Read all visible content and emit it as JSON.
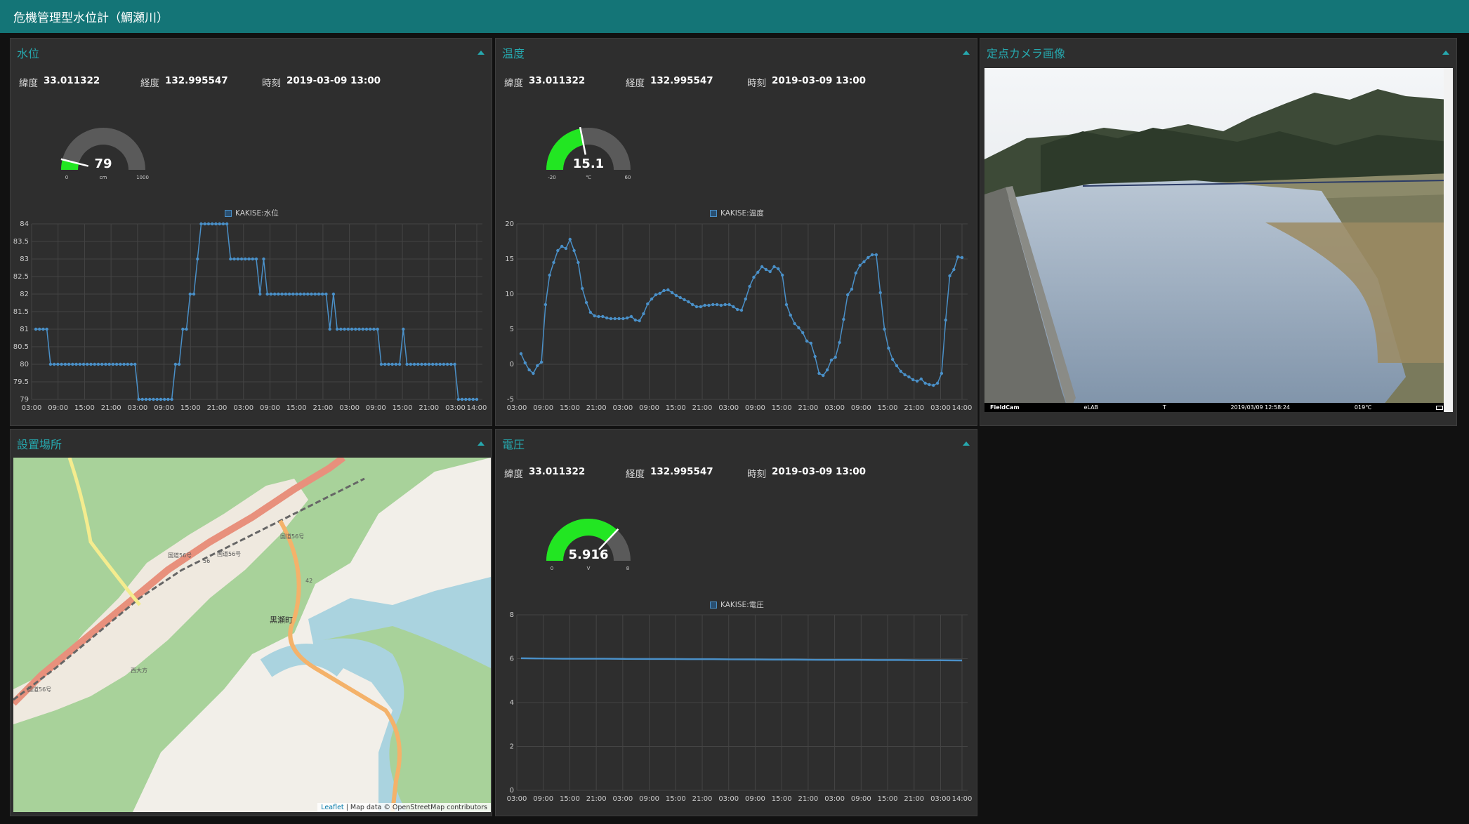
{
  "app": {
    "title": "危機管理型水位計（鯛瀬川）"
  },
  "colors": {
    "accent": "#26a8ae",
    "topbar": "#147577",
    "panel": "#2e2e2e",
    "gauge_fill": "#22e622",
    "gauge_track": "#5a5a5a",
    "line": "#4a90c8"
  },
  "location": {
    "lat_label": "緯度",
    "lat": "33.011322",
    "lon_label": "経度",
    "lon": "132.995547",
    "time_label": "時刻",
    "time": "2019-03-09 13:00"
  },
  "x_ticks": [
    "03:00",
    "09:00",
    "15:00",
    "21:00",
    "03:00",
    "09:00",
    "15:00",
    "21:00",
    "03:00",
    "09:00",
    "15:00",
    "21:00",
    "03:00",
    "09:00",
    "15:00",
    "21:00",
    "03:00",
    "14:00"
  ],
  "panels": {
    "water": {
      "title": "水位",
      "gauge": {
        "value": 79,
        "min": 0,
        "max": 1000,
        "unit": "cm",
        "value_text": "79",
        "min_text": "0",
        "max_text": "1000"
      },
      "legend": "KAKISE:水位",
      "y_ticks": [
        "84",
        "83.5",
        "83",
        "82.5",
        "82",
        "81.5",
        "81",
        "80.5",
        "80",
        "79.5",
        "79"
      ]
    },
    "temp": {
      "title": "温度",
      "gauge": {
        "value": 15.1,
        "min": -20,
        "max": 60,
        "unit": "℃",
        "value_text": "15.1",
        "min_text": "-20",
        "max_text": "60"
      },
      "legend": "KAKISE:温度",
      "y_ticks": [
        "20",
        "15",
        "10",
        "5",
        "0",
        "-5"
      ]
    },
    "camera": {
      "title": "定点カメラ画像",
      "strip": {
        "brand": "FieldCam",
        "lab": "eLAB",
        "mode": "T",
        "datetime": "2019/03/09 12:58:24",
        "temp": "019℃"
      }
    },
    "map": {
      "title": "設置場所",
      "place_main": "黒瀬町",
      "place_sub": "西大方",
      "roads": [
        "国道56号",
        "国道56号",
        "国道56号",
        "国道56号"
      ],
      "route_no": "42",
      "route_no2": "56",
      "attribution_link": "Leaflet",
      "attribution_text": "| Map data © OpenStreetMap contributors"
    },
    "voltage": {
      "title": "電圧",
      "gauge": {
        "value": 5.916,
        "min": 0,
        "max": 8,
        "unit": "V",
        "value_text": "5.916",
        "min_text": "0",
        "max_text": "8"
      },
      "legend": "KAKISE:電圧",
      "y_ticks": [
        "8",
        "6",
        "4",
        "2",
        "0"
      ]
    }
  },
  "chart_data": [
    {
      "type": "line",
      "series": [
        {
          "name": "KAKISE:水位",
          "values": [
            81,
            81,
            81,
            81,
            80,
            80,
            80,
            80,
            80,
            80,
            80,
            80,
            80,
            80,
            80,
            80,
            80,
            80,
            80,
            80,
            80,
            80,
            80,
            80,
            80,
            80,
            80,
            80,
            79,
            79,
            79,
            79,
            79,
            79,
            79,
            79,
            79,
            79,
            80,
            80,
            81,
            81,
            82,
            82,
            83,
            84,
            84,
            84,
            84,
            84,
            84,
            84,
            84,
            83,
            83,
            83,
            83,
            83,
            83,
            83,
            83,
            82,
            83,
            82,
            82,
            82,
            82,
            82,
            82,
            82,
            82,
            82,
            82,
            82,
            82,
            82,
            82,
            82,
            82,
            82,
            81,
            82,
            81,
            81,
            81,
            81,
            81,
            81,
            81,
            81,
            81,
            81,
            81,
            81,
            80,
            80,
            80,
            80,
            80,
            80,
            81,
            80,
            80,
            80,
            80,
            80,
            80,
            80,
            80,
            80,
            80,
            80,
            80,
            80,
            80,
            79,
            79,
            79,
            79,
            79,
            79
          ]
        }
      ],
      "ylim": [
        79,
        84
      ]
    },
    {
      "type": "line",
      "series": [
        {
          "name": "KAKISE:温度",
          "values": [
            1.5,
            0.2,
            -0.8,
            -1.3,
            -0.2,
            0.3,
            8.5,
            12.7,
            14.5,
            16.2,
            16.8,
            16.5,
            17.8,
            16.2,
            14.5,
            10.8,
            8.8,
            7.4,
            6.9,
            6.8,
            6.8,
            6.6,
            6.5,
            6.5,
            6.5,
            6.5,
            6.6,
            6.8,
            6.3,
            6.2,
            7.2,
            8.6,
            9.3,
            9.9,
            10.1,
            10.5,
            10.6,
            10.2,
            9.8,
            9.5,
            9.2,
            8.9,
            8.5,
            8.2,
            8.2,
            8.4,
            8.4,
            8.5,
            8.5,
            8.4,
            8.5,
            8.5,
            8.2,
            7.8,
            7.7,
            9.3,
            11.1,
            12.4,
            13.1,
            13.9,
            13.5,
            13.2,
            13.9,
            13.6,
            12.7,
            8.5,
            7.0,
            5.8,
            5.2,
            4.5,
            3.3,
            3.0,
            1.1,
            -1.3,
            -1.6,
            -0.8,
            0.6,
            1.0,
            3.1,
            6.4,
            9.9,
            10.7,
            13.0,
            14.1,
            14.6,
            15.2,
            15.6,
            15.6,
            10.2,
            5.0,
            2.3,
            0.7,
            -0.2,
            -1.0,
            -1.5,
            -1.8,
            -2.2,
            -2.4,
            -2.1,
            -2.7,
            -2.9,
            -3.0,
            -2.7,
            -1.3,
            6.3,
            12.6,
            13.5,
            15.3,
            15.2
          ]
        }
      ],
      "ylim": [
        -5,
        20
      ]
    },
    {
      "type": "line",
      "series": [
        {
          "name": "KAKISE:電圧",
          "values": [
            6.02,
            6.01,
            6.0,
            6.0,
            6.0,
            5.99,
            5.99,
            5.99,
            5.98,
            5.98,
            5.97,
            5.97,
            5.96,
            5.96,
            5.95,
            5.95,
            5.95,
            5.94,
            5.94,
            5.93,
            5.93,
            5.92
          ]
        }
      ],
      "ylim": [
        0,
        8
      ]
    }
  ]
}
